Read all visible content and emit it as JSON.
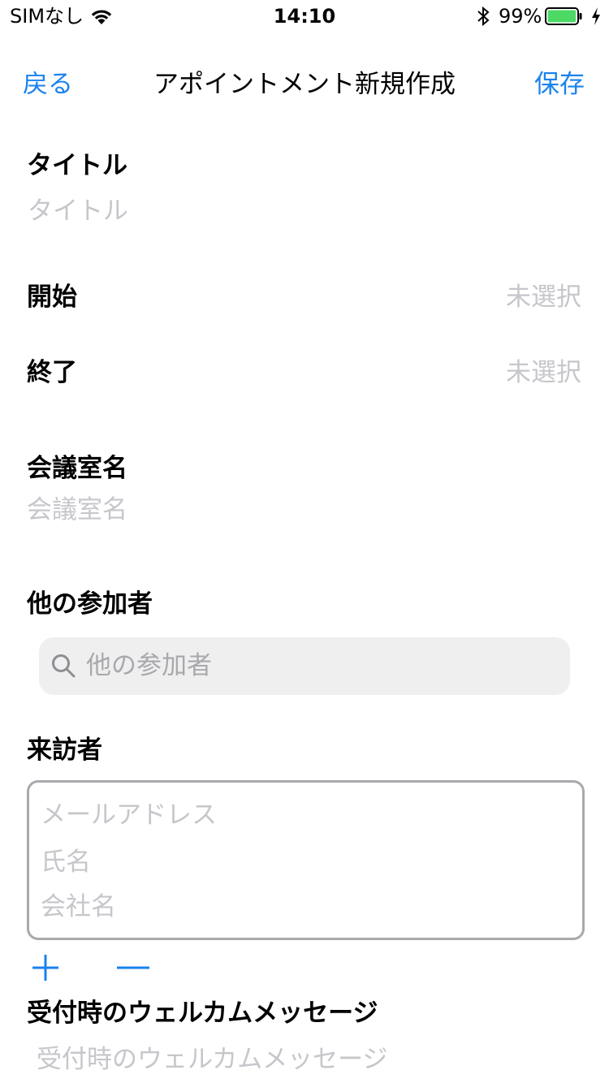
{
  "status_bar": {
    "carrier": "SIMなし",
    "time": "14:10",
    "battery_percent": "99%",
    "battery_level": 0.99,
    "battery_color": "#4cd964"
  },
  "nav": {
    "back_label": "戻る",
    "title": "アポイントメント新規作成",
    "save_label": "保存",
    "accent_color": "#1a82ee"
  },
  "form": {
    "title_label": "タイトル",
    "title_placeholder": "タイトル",
    "start_label": "開始",
    "start_value": "未選択",
    "end_label": "終了",
    "end_value": "未選択",
    "room_label": "会議室名",
    "room_placeholder": "会議室名",
    "participants_label": "他の参加者",
    "participants_search_placeholder": "他の参加者",
    "visitor_label": "来訪者",
    "visitor_email_placeholder": "メールアドレス",
    "visitor_name_placeholder": "氏名",
    "visitor_company_placeholder": "会社名",
    "welcome_label": "受付時のウェルカムメッセージ",
    "welcome_placeholder": "受付時のウェルカムメッセージ"
  },
  "icons": {
    "wifi": "wifi-icon",
    "bluetooth": "bluetooth-icon",
    "battery": "battery-icon",
    "charging": "charging-icon",
    "search": "search-icon",
    "add": "plus-icon",
    "remove": "minus-icon"
  }
}
